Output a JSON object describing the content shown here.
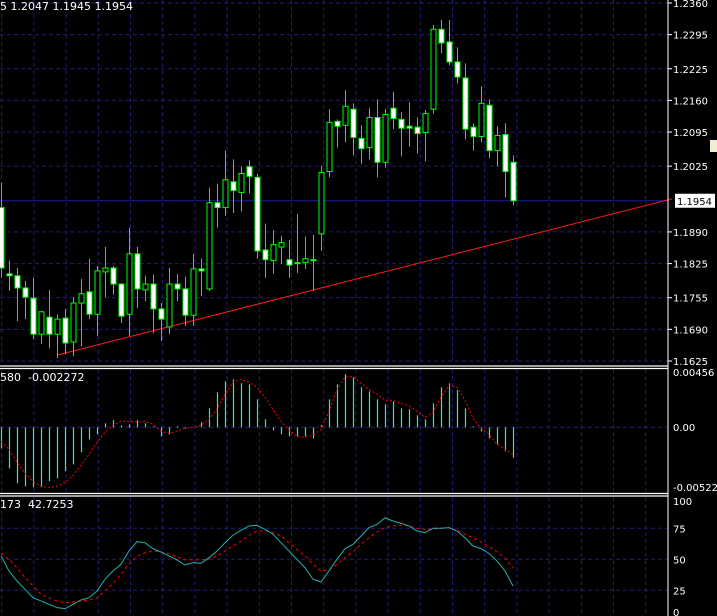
{
  "header": {
    "main_ohlc": "5 1.2047 1.1945 1.1954",
    "macd_values": "580  -0.002272",
    "stoch_values": "173  42.7253"
  },
  "colors": {
    "background": "#000000",
    "grid": "#1e1e78",
    "candle": "#00ff00",
    "bear_fill": "#ffffff",
    "bull_fill": "#000000",
    "bid_line": "#1a1aa8",
    "trendline": "#ff1a1a",
    "macd_histogram": "#3ce6a0",
    "macd_signal": "#ff0000",
    "stoch_main": "#20b2aa",
    "stoch_signal": "#ff0000",
    "separator": "#ffffff"
  },
  "chart_data": [
    {
      "type": "candlestick",
      "panel": "price",
      "yrange": [
        1.1625,
        1.236
      ],
      "y_ticks": [
        "1.2360",
        "1.2295",
        "1.2225",
        "1.2160",
        "1.2095",
        "1.2025",
        "1.1890",
        "1.1825",
        "1.1755",
        "1.1690",
        "1.1625"
      ],
      "bid": {
        "price": 1.1954,
        "label": "1.1954"
      },
      "trendline": {
        "points": [
          {
            "bar": 8,
            "price": 1.1637
          },
          {
            "bar": 65,
            "price": 1.1875
          }
        ],
        "extends_right": true
      },
      "ohlc": [
        [
          1.194,
          1.1991,
          1.1796,
          1.1816
        ],
        [
          1.1804,
          1.1831,
          1.1769,
          1.18
        ],
        [
          1.18,
          1.1816,
          1.1707,
          1.1775
        ],
        [
          1.1775,
          1.1789,
          1.1711,
          1.1756
        ],
        [
          1.1754,
          1.1796,
          1.167,
          1.168
        ],
        [
          1.168,
          1.1728,
          1.166,
          1.1726
        ],
        [
          1.1715,
          1.1771,
          1.1651,
          1.168
        ],
        [
          1.168,
          1.1721,
          1.1631,
          1.1711
        ],
        [
          1.1713,
          1.1732,
          1.1639,
          1.1662
        ],
        [
          1.1664,
          1.1756,
          1.1635,
          1.1744
        ],
        [
          1.1744,
          1.1793,
          1.1655,
          1.1763
        ],
        [
          1.1767,
          1.1835,
          1.1711,
          1.1721
        ],
        [
          1.1721,
          1.182,
          1.1676,
          1.181
        ],
        [
          1.1808,
          1.1859,
          1.1756,
          1.1816
        ],
        [
          1.1816,
          1.182,
          1.1761,
          1.1783
        ],
        [
          1.1783,
          1.1785,
          1.1703,
          1.1717
        ],
        [
          1.1721,
          1.1899,
          1.1676,
          1.1845
        ],
        [
          1.1845,
          1.1859,
          1.1734,
          1.1773
        ],
        [
          1.1771,
          1.18,
          1.1748,
          1.1783
        ],
        [
          1.1783,
          1.1802,
          1.1682,
          1.1732
        ],
        [
          1.1732,
          1.1744,
          1.1666,
          1.1711
        ],
        [
          1.1695,
          1.1816,
          1.168,
          1.1783
        ],
        [
          1.1783,
          1.1804,
          1.1748,
          1.1773
        ],
        [
          1.1773,
          1.1798,
          1.1697,
          1.1719
        ],
        [
          1.1719,
          1.1845,
          1.1697,
          1.1814
        ],
        [
          1.1814,
          1.1835,
          1.1758,
          1.181
        ],
        [
          1.1773,
          1.1981,
          1.1769,
          1.195
        ],
        [
          1.195,
          1.1989,
          1.1899,
          1.194
        ],
        [
          1.194,
          1.2057,
          1.1923,
          1.1997
        ],
        [
          1.1993,
          1.2039,
          1.1929,
          1.1975
        ],
        [
          1.1971,
          1.2024,
          1.1932,
          1.201
        ],
        [
          1.2024,
          1.2037,
          1.1969,
          1.2004
        ],
        [
          1.2002,
          1.201,
          1.1835,
          1.1851
        ],
        [
          1.1853,
          1.1907,
          1.1796,
          1.1833
        ],
        [
          1.1831,
          1.1894,
          1.1804,
          1.1864
        ],
        [
          1.1859,
          1.1882,
          1.1824,
          1.1868
        ],
        [
          1.1833,
          1.1874,
          1.1796,
          1.1822
        ],
        [
          1.1827,
          1.1927,
          1.1806,
          1.1825
        ],
        [
          1.1827,
          1.188,
          1.1814,
          1.1835
        ],
        [
          1.1833,
          1.1884,
          1.1769,
          1.1833
        ],
        [
          1.1886,
          1.2026,
          1.1851,
          1.2012
        ],
        [
          1.2014,
          1.2142,
          1.2002,
          1.2115
        ],
        [
          1.2117,
          1.2121,
          1.2063,
          1.2107
        ],
        [
          1.2109,
          1.2181,
          1.2074,
          1.2148
        ],
        [
          1.2142,
          1.2154,
          1.2047,
          1.2084
        ],
        [
          1.2082,
          1.2109,
          1.203,
          1.2061
        ],
        [
          1.2063,
          1.2144,
          1.2039,
          1.2125
        ],
        [
          1.2125,
          1.2162,
          1.2002,
          1.2033
        ],
        [
          1.2033,
          1.2142,
          1.2022,
          1.2131
        ],
        [
          1.2144,
          1.2177,
          1.2101,
          1.2123
        ],
        [
          1.2121,
          1.2136,
          1.2045,
          1.2103
        ],
        [
          1.2107,
          1.2156,
          1.2065,
          1.2103
        ],
        [
          1.2105,
          1.2125,
          1.2051,
          1.2092
        ],
        [
          1.2094,
          1.214,
          1.2035,
          1.2133
        ],
        [
          1.2142,
          1.2315,
          1.2133,
          1.2306
        ],
        [
          1.2306,
          1.2325,
          1.2257,
          1.2278
        ],
        [
          1.228,
          1.2325,
          1.2232,
          1.2239
        ],
        [
          1.2239,
          1.2269,
          1.2195,
          1.2208
        ],
        [
          1.2206,
          1.2236,
          1.208,
          1.2101
        ],
        [
          1.2105,
          1.2113,
          1.2057,
          1.2086
        ],
        [
          1.2086,
          1.2189,
          1.2074,
          1.2154
        ],
        [
          1.215,
          1.2162,
          1.2041,
          1.2057
        ],
        [
          1.2057,
          1.2107,
          1.2024,
          1.2088
        ],
        [
          1.209,
          1.2113,
          1.1961,
          1.2014
        ],
        [
          1.2033,
          1.2047,
          1.1945,
          1.1954
        ]
      ]
    },
    {
      "type": "bar+line",
      "panel": "macd",
      "yrange": [
        -0.00522,
        0.00456
      ],
      "y_ticks": [
        "0.00456",
        "0.00",
        "-0.00522"
      ],
      "histogram": [
        -0.00179,
        -0.00349,
        -0.00476,
        -0.00502,
        -0.0051,
        -0.0051,
        -0.00459,
        -0.00434,
        -0.00374,
        -0.00315,
        -0.00213,
        -0.00102,
        -0.0006,
        0.00034,
        0.0006,
        0.00017,
        0.00026,
        0.0006,
        0.00034,
        9e-05,
        -0.00077,
        -0.0006,
        9e-05,
        -9e-05,
        0,
        0.00043,
        0.00162,
        0.00298,
        0.00391,
        0.00408,
        0.00374,
        0.00366,
        0.00238,
        0.00068,
        -0.00026,
        -0.0006,
        -0.00077,
        -0.00077,
        -0.00077,
        -0.00094,
        0.00017,
        0.00238,
        0.00366,
        0.00451,
        0.00425,
        0.0034,
        0.00306,
        0.00238,
        0.00196,
        0.00221,
        0.00162,
        0.00153,
        0.00102,
        0.00068,
        0.00204,
        0.0034,
        0.00374,
        0.00315,
        0.00162,
        9e-05,
        -0.00034,
        -0.00094,
        -0.00145,
        -0.00204,
        -0.00258
      ],
      "signal": [
        -0.00119,
        -0.00187,
        -0.00298,
        -0.00391,
        -0.00459,
        -0.00502,
        -0.0051,
        -0.00502,
        -0.00468,
        -0.00408,
        -0.00323,
        -0.0023,
        -0.00128,
        -0.00043,
        0.00017,
        0.00051,
        0.00051,
        0.00043,
        0.00051,
        0.00026,
        -0.00034,
        -0.00051,
        -0.00034,
        -9e-05,
        0,
        0.00017,
        0.00068,
        0.00153,
        0.00281,
        0.00383,
        0.00408,
        0.00383,
        0.0034,
        0.00255,
        0.00153,
        0.00051,
        -0.00026,
        -0.00077,
        -0.00085,
        -0.00068,
        -0.00017,
        0.00136,
        0.00323,
        0.00425,
        0.00434,
        0.00374,
        0.00323,
        0.00281,
        0.0023,
        0.0023,
        0.00204,
        0.00179,
        0.00136,
        0.00085,
        0.00128,
        0.00255,
        0.00357,
        0.0034,
        0.0023,
        0.00077,
        -9e-05,
        -0.0006,
        -0.00145,
        -0.00187,
        -0.002272
      ]
    },
    {
      "type": "line",
      "panel": "stochastic",
      "yrange": [
        0,
        100
      ],
      "y_ticks": [
        "100",
        "75",
        "50",
        "25",
        "0"
      ],
      "levels": [
        75,
        50,
        25
      ],
      "main": [
        52.7,
        40.6,
        32.5,
        25.8,
        19,
        16.4,
        13.7,
        11,
        10.2,
        13.7,
        17.2,
        19,
        24.4,
        33.9,
        40.6,
        46,
        56.7,
        64.2,
        63.4,
        58.6,
        55.9,
        52.7,
        49.5,
        45.4,
        47.3,
        46.8,
        51.3,
        56.7,
        63.4,
        69.4,
        73.4,
        76.9,
        77.4,
        74.2,
        70.2,
        63.4,
        56.7,
        50,
        43.2,
        33.9,
        31.7,
        40.6,
        50,
        58.6,
        62.1,
        68.8,
        75.5,
        78.2,
        83.5,
        80.9,
        79,
        76.9,
        72.8,
        71.5,
        75,
        75,
        75.5,
        72.8,
        67.4,
        60.7,
        58.6,
        54.8,
        48.6,
        40.6,
        28.5
      ],
      "signal": [
        54.8,
        50,
        43.2,
        35.2,
        28.5,
        21.8,
        19,
        16.4,
        15,
        15.6,
        16.4,
        17.2,
        19,
        24.4,
        30.6,
        37.9,
        46,
        52.7,
        55.3,
        56.5,
        56,
        54.5,
        52,
        49.5,
        49.5,
        49.5,
        50.1,
        52.7,
        56.7,
        60.7,
        64.7,
        69.4,
        72.8,
        72.8,
        71.6,
        68.8,
        63.4,
        58,
        52.7,
        46,
        40.6,
        41.4,
        46,
        51.3,
        55.9,
        62.1,
        67.4,
        72,
        75.5,
        76.9,
        77.4,
        76.9,
        75,
        74.2,
        74.2,
        75,
        75.3,
        73.6,
        70.2,
        67.4,
        64,
        60.2,
        55.9,
        51.3,
        42.7253
      ]
    }
  ]
}
